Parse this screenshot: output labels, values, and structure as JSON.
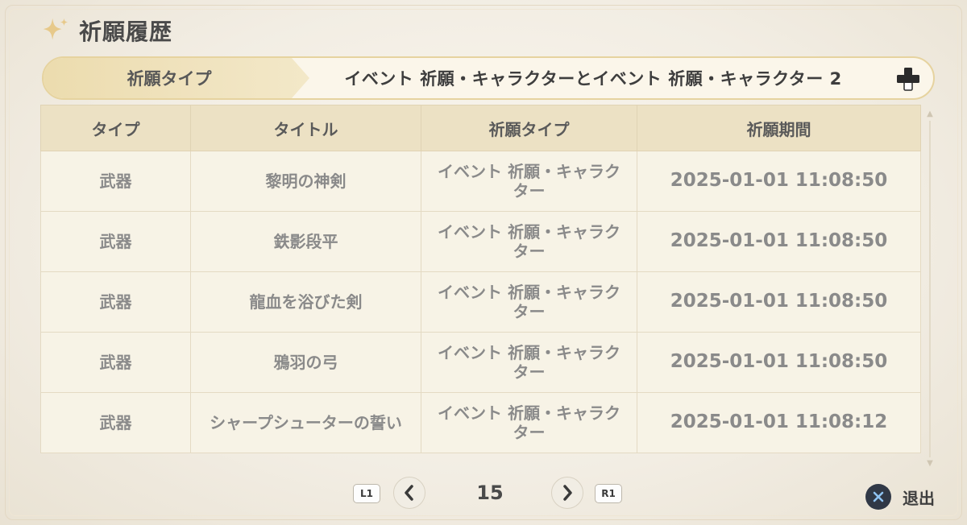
{
  "header": {
    "title": "祈願履歴"
  },
  "banner": {
    "label": "祈願タイプ",
    "value": "イベント 祈願・キャラクターとイベント 祈願・キャラクター 2"
  },
  "table": {
    "headers": [
      "タイプ",
      "タイトル",
      "祈願タイプ",
      "祈願期間"
    ],
    "rows": [
      {
        "type": "武器",
        "title": "黎明の神剣",
        "wish_type": "イベント 祈願・キャラクター",
        "time": "2025-01-01 11:08:50"
      },
      {
        "type": "武器",
        "title": "鉄影段平",
        "wish_type": "イベント 祈願・キャラクター",
        "time": "2025-01-01 11:08:50"
      },
      {
        "type": "武器",
        "title": "龍血を浴びた剣",
        "wish_type": "イベント 祈願・キャラクター",
        "time": "2025-01-01 11:08:50"
      },
      {
        "type": "武器",
        "title": "鴉羽の弓",
        "wish_type": "イベント 祈願・キャラクター",
        "time": "2025-01-01 11:08:50"
      },
      {
        "type": "武器",
        "title": "シャープシューターの誓い",
        "wish_type": "イベント 祈願・キャラクター",
        "time": "2025-01-01 11:08:12"
      }
    ]
  },
  "pager": {
    "prev_key": "L1",
    "next_key": "R1",
    "page": "15"
  },
  "exit": {
    "label": "退出"
  },
  "icons": {
    "title": "sparkle-icon",
    "banner": "dpad-icon",
    "prev": "chevron-left-icon",
    "next": "chevron-right-icon",
    "exit": "cross-button-icon"
  },
  "colors": {
    "accent": "#e6d39f",
    "header_row": "#ece1c4",
    "cell_bg": "#f7f3e6",
    "exit_button": "#303846"
  }
}
